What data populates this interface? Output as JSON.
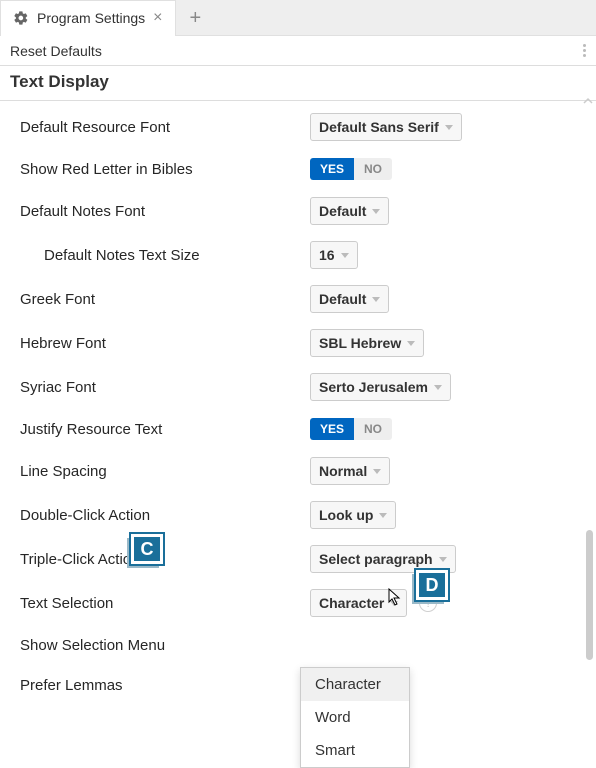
{
  "tab": {
    "title": "Program Settings"
  },
  "subbar": {
    "reset": "Reset Defaults"
  },
  "section": "Text Display",
  "rows": {
    "defaultResourceFont": {
      "label": "Default Resource Font",
      "value": "Default Sans Serif"
    },
    "showRedLetter": {
      "label": "Show Red Letter in Bibles",
      "yes": "YES",
      "no": "NO"
    },
    "defaultNotesFont": {
      "label": "Default Notes Font",
      "value": "Default"
    },
    "defaultNotesTextSize": {
      "label": "Default Notes Text Size",
      "value": "16"
    },
    "greekFont": {
      "label": "Greek Font",
      "value": "Default"
    },
    "hebrewFont": {
      "label": "Hebrew Font",
      "value": "SBL Hebrew"
    },
    "syriacFont": {
      "label": "Syriac Font",
      "value": "Serto Jerusalem"
    },
    "justify": {
      "label": "Justify Resource Text",
      "yes": "YES",
      "no": "NO"
    },
    "lineSpacing": {
      "label": "Line Spacing",
      "value": "Normal"
    },
    "doubleClick": {
      "label": "Double-Click Action",
      "value": "Look up"
    },
    "tripleClick": {
      "label": "Triple-Click Action",
      "value": "Select paragraph"
    },
    "textSelection": {
      "label": "Text Selection",
      "value": "Character"
    },
    "showSelectionMenu": {
      "label": "Show Selection Menu"
    },
    "preferLemmas": {
      "label": "Prefer Lemmas"
    }
  },
  "dropdownMenu": {
    "items": [
      "Character",
      "Word",
      "Smart"
    ]
  },
  "markers": {
    "c": "C",
    "d": "D"
  }
}
